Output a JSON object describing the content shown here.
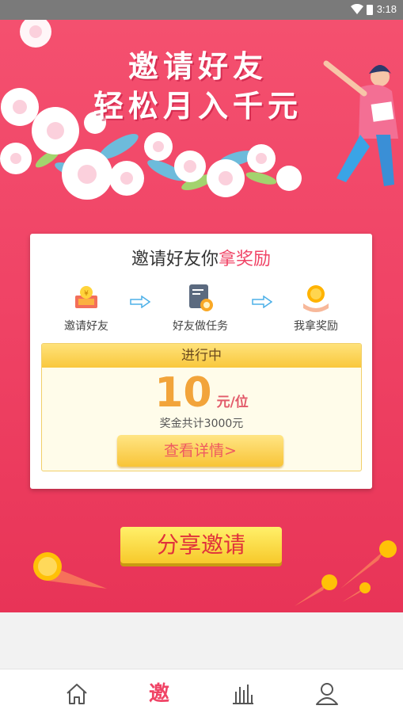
{
  "status_bar": {
    "time": "3:18"
  },
  "hero": {
    "headline_line1": "邀请好友",
    "headline_line2": "轻松月入千元"
  },
  "card": {
    "title_main": "邀请好友你",
    "title_highlight": "拿奖励",
    "steps": [
      {
        "label": "邀请好友",
        "icon": "gold-bar-icon"
      },
      {
        "label": "好友做任务",
        "icon": "task-document-icon"
      },
      {
        "label": "我拿奖励",
        "icon": "coin-hand-icon"
      }
    ],
    "progress": {
      "status": "进行中",
      "amount": "10",
      "unit": "元/位",
      "total": "奖金共计3000元",
      "detail_button": "查看详情>"
    }
  },
  "share_button": "分享邀请",
  "bottom_nav": {
    "items": [
      {
        "name": "home",
        "icon": "home-icon"
      },
      {
        "name": "invite",
        "glyph": "邀",
        "active": true
      },
      {
        "name": "stats",
        "icon": "bar-chart-icon"
      },
      {
        "name": "profile",
        "icon": "user-icon"
      }
    ]
  },
  "colors": {
    "accent": "#f04466",
    "gold": "#f8c437",
    "amount": "#f2a43a"
  }
}
